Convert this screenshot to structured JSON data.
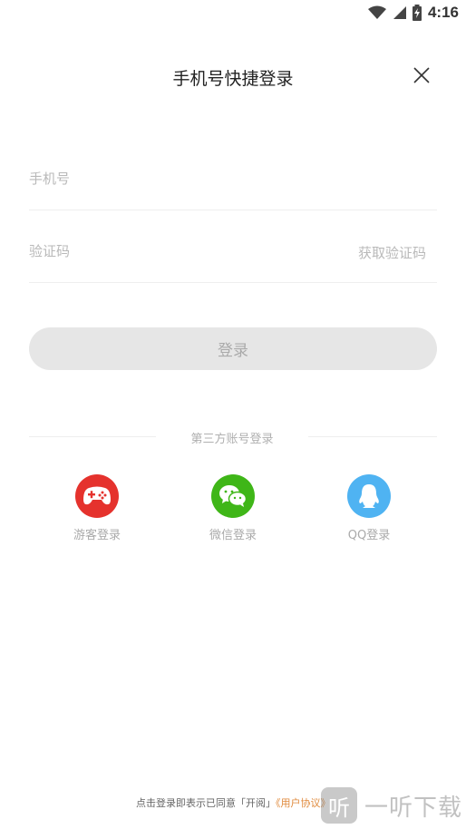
{
  "status_bar": {
    "time": "4:16"
  },
  "header": {
    "title": "手机号快捷登录"
  },
  "form": {
    "phone_placeholder": "手机号",
    "code_placeholder": "验证码",
    "get_code_label": "获取验证码",
    "login_label": "登录"
  },
  "third_party": {
    "title": "第三方账号登录",
    "items": [
      {
        "label": "游客登录",
        "icon": "gamepad-icon",
        "color": "#e5322d"
      },
      {
        "label": "微信登录",
        "icon": "wechat-icon",
        "color": "#3fb618"
      },
      {
        "label": "QQ登录",
        "icon": "qq-penguin-icon",
        "color": "#4fb3f2"
      }
    ]
  },
  "footer": {
    "agreement_text": "点击登录即表示已同意「开阅」",
    "agreement_link": "《用户协议》"
  },
  "watermark": {
    "glyph": "听",
    "text": "一听下载"
  },
  "colors": {
    "link": "#e08a3c",
    "button_disabled": "#e6e6e6",
    "placeholder": "#b9b9b9"
  }
}
